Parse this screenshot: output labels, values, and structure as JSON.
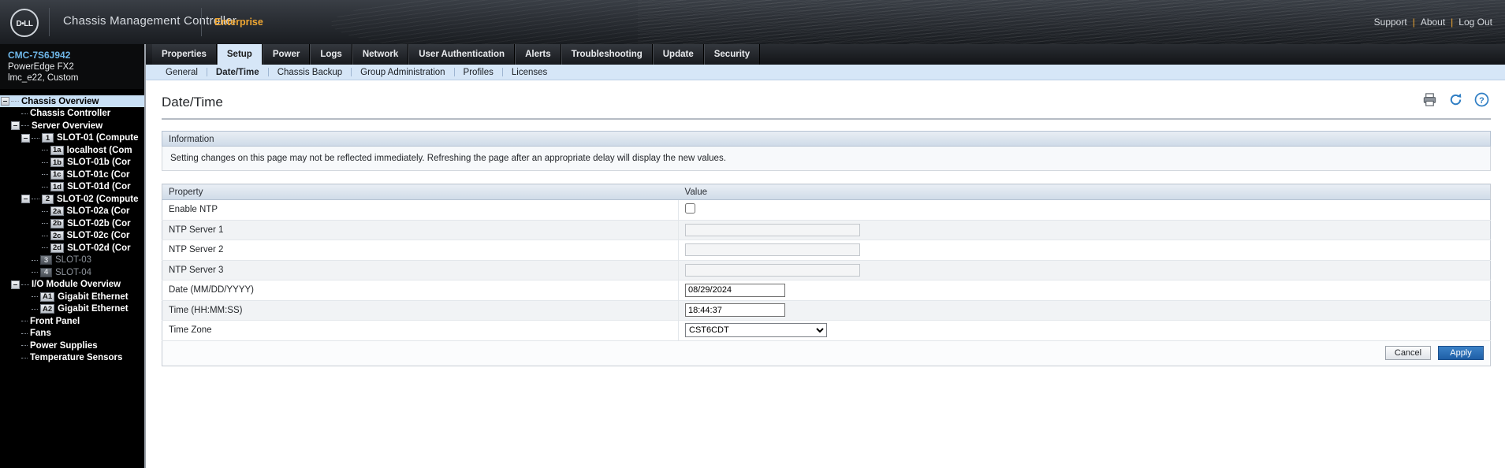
{
  "header": {
    "logo_text": "D☈LL",
    "title": "Chassis Management Controller",
    "edition": "Enterprise",
    "links": [
      {
        "label": "Support"
      },
      {
        "label": "About"
      },
      {
        "label": "Log Out"
      }
    ],
    "link_separator": "|"
  },
  "sidebar": {
    "device_id": "CMC-7S6J942",
    "model": "PowerEdge FX2",
    "custom": "lmc_e22, Custom",
    "tree": [
      {
        "label": "Chassis Overview",
        "indent": 0,
        "toggle": true,
        "selected": true,
        "badge": null,
        "dim": false
      },
      {
        "label": "Chassis Controller",
        "indent": 1,
        "toggle": false,
        "selected": false,
        "badge": null,
        "dim": false
      },
      {
        "label": "Server Overview",
        "indent": 1,
        "toggle": true,
        "selected": false,
        "badge": null,
        "dim": false
      },
      {
        "label": "SLOT-01 (Compute",
        "indent": 2,
        "toggle": true,
        "selected": false,
        "badge": "1",
        "dim": false
      },
      {
        "label": "localhost (Com",
        "indent": 3,
        "toggle": false,
        "selected": false,
        "badge": "1a",
        "dim": false
      },
      {
        "label": "SLOT-01b (Cor",
        "indent": 3,
        "toggle": false,
        "selected": false,
        "badge": "1b",
        "dim": false
      },
      {
        "label": "SLOT-01c (Cor",
        "indent": 3,
        "toggle": false,
        "selected": false,
        "badge": "1c",
        "dim": false
      },
      {
        "label": "SLOT-01d (Cor",
        "indent": 3,
        "toggle": false,
        "selected": false,
        "badge": "1d",
        "dim": false
      },
      {
        "label": "SLOT-02 (Compute",
        "indent": 2,
        "toggle": true,
        "selected": false,
        "badge": "2",
        "dim": false
      },
      {
        "label": "SLOT-02a (Cor",
        "indent": 3,
        "toggle": false,
        "selected": false,
        "badge": "2a",
        "dim": false
      },
      {
        "label": "SLOT-02b (Cor",
        "indent": 3,
        "toggle": false,
        "selected": false,
        "badge": "2b",
        "dim": false
      },
      {
        "label": "SLOT-02c (Cor",
        "indent": 3,
        "toggle": false,
        "selected": false,
        "badge": "2c",
        "dim": false
      },
      {
        "label": "SLOT-02d (Cor",
        "indent": 3,
        "toggle": false,
        "selected": false,
        "badge": "2d",
        "dim": false
      },
      {
        "label": "SLOT-03",
        "indent": 2,
        "toggle": false,
        "selected": false,
        "badge": "3",
        "dim": true
      },
      {
        "label": "SLOT-04",
        "indent": 2,
        "toggle": false,
        "selected": false,
        "badge": "4",
        "dim": true
      },
      {
        "label": "I/O Module Overview",
        "indent": 1,
        "toggle": true,
        "selected": false,
        "badge": null,
        "dim": false
      },
      {
        "label": "Gigabit Ethernet",
        "indent": 2,
        "toggle": false,
        "selected": false,
        "badge": "A1",
        "dim": false
      },
      {
        "label": "Gigabit Ethernet",
        "indent": 2,
        "toggle": false,
        "selected": false,
        "badge": "A2",
        "dim": false
      },
      {
        "label": "Front Panel",
        "indent": 1,
        "toggle": false,
        "selected": false,
        "badge": null,
        "dim": false
      },
      {
        "label": "Fans",
        "indent": 1,
        "toggle": false,
        "selected": false,
        "badge": null,
        "dim": false
      },
      {
        "label": "Power Supplies",
        "indent": 1,
        "toggle": false,
        "selected": false,
        "badge": null,
        "dim": false
      },
      {
        "label": "Temperature Sensors",
        "indent": 1,
        "toggle": false,
        "selected": false,
        "badge": null,
        "dim": false
      }
    ]
  },
  "tabs": [
    {
      "label": "Properties",
      "active": false
    },
    {
      "label": "Setup",
      "active": true
    },
    {
      "label": "Power",
      "active": false
    },
    {
      "label": "Logs",
      "active": false
    },
    {
      "label": "Network",
      "active": false
    },
    {
      "label": "User Authentication",
      "active": false
    },
    {
      "label": "Alerts",
      "active": false
    },
    {
      "label": "Troubleshooting",
      "active": false
    },
    {
      "label": "Update",
      "active": false
    },
    {
      "label": "Security",
      "active": false
    }
  ],
  "subnav": [
    {
      "label": "General",
      "active": false
    },
    {
      "label": "Date/Time",
      "active": true
    },
    {
      "label": "Chassis Backup",
      "active": false
    },
    {
      "label": "Group Administration",
      "active": false
    },
    {
      "label": "Profiles",
      "active": false
    },
    {
      "label": "Licenses",
      "active": false
    }
  ],
  "page": {
    "title": "Date/Time",
    "icons": [
      {
        "name": "print-icon"
      },
      {
        "name": "refresh-icon"
      },
      {
        "name": "help-icon"
      }
    ]
  },
  "information": {
    "header": "Information",
    "text": "Setting changes on this page may not be reflected immediately. Refreshing the page after an appropriate delay will display the new values."
  },
  "property_table": {
    "columns": [
      "Property",
      "Value"
    ],
    "rows": [
      {
        "property": "Enable NTP",
        "type": "checkbox",
        "value": "",
        "checked": false,
        "placeholder": ""
      },
      {
        "property": "NTP Server 1",
        "type": "text",
        "value": "",
        "placeholder": ""
      },
      {
        "property": "NTP Server 2",
        "type": "text",
        "value": "",
        "placeholder": ""
      },
      {
        "property": "NTP Server 3",
        "type": "text",
        "value": "",
        "placeholder": ""
      },
      {
        "property": "Date (MM/DD/YYYY)",
        "type": "text-filled",
        "value": "08/29/2024",
        "placeholder": ""
      },
      {
        "property": "Time (HH:MM:SS)",
        "type": "text-filled",
        "value": "18:44:37",
        "placeholder": ""
      },
      {
        "property": "Time Zone",
        "type": "select",
        "value": "CST6CDT",
        "options": [
          "CST6CDT"
        ]
      }
    ]
  },
  "buttons": {
    "cancel": "Cancel",
    "apply": "Apply"
  },
  "colors": {
    "accent_blue": "#6fb7e8",
    "edition_orange": "#f0a732",
    "tab_active_bg": "#d6e6f7",
    "primary_button": "#1f5fa6"
  }
}
